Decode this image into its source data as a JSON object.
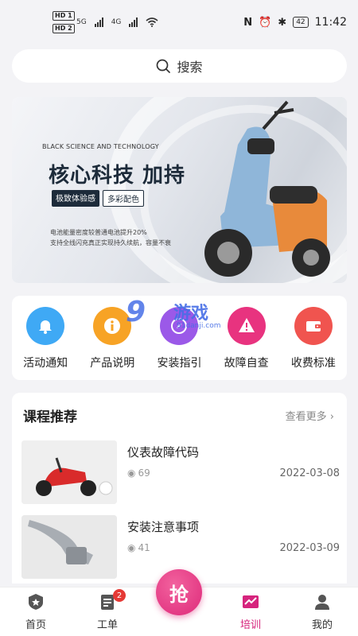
{
  "status_bar": {
    "hd1": "HD 1",
    "hd2": "HD 2",
    "net1": "5G",
    "net2": "4G",
    "battery": "42",
    "time": "11:42"
  },
  "search": {
    "label": "搜索"
  },
  "banner": {
    "subtitle": "BLACK SCIENCE AND TECHNOLOGY",
    "title": "核心科技 加持",
    "tag1": "极致体验感",
    "tag2": "多彩配色",
    "desc1": "电池能量密度较普通电池提升20%",
    "desc2": "支持全线闪充真正实现持久续航，容量不衰"
  },
  "menu": {
    "items": [
      {
        "label": "活动通知",
        "icon": "bell-icon",
        "color": "#3fa9f5"
      },
      {
        "label": "产品说明",
        "icon": "info-icon",
        "color": "#f7a325"
      },
      {
        "label": "安装指引",
        "icon": "compass-icon",
        "color": "#9b59e8"
      },
      {
        "label": "故障自查",
        "icon": "warning-icon",
        "color": "#e8337f"
      },
      {
        "label": "收费标准",
        "icon": "wallet-icon",
        "color": "#f0544f"
      }
    ]
  },
  "watermark": {
    "big": "9",
    "cn": "游戏",
    "url": "91danji.com"
  },
  "courses": {
    "title": "课程推荐",
    "more": "查看更多",
    "items": [
      {
        "title": "仪表故障代码",
        "views": "69",
        "date": "2022-03-08"
      },
      {
        "title": "安装注意事项",
        "views": "41",
        "date": "2022-03-09"
      }
    ]
  },
  "tabbar": {
    "home": "首页",
    "orders": "工单",
    "orders_badge": "2",
    "grab": "抢",
    "training": "培训",
    "mine": "我的"
  },
  "colors": {
    "accent": "#d6247d",
    "badge": "#e53935"
  }
}
